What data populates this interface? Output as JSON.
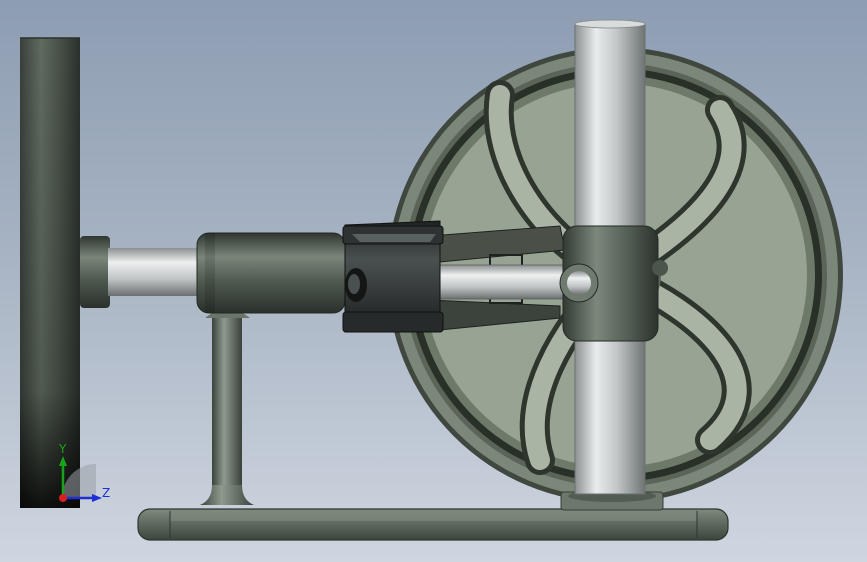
{
  "viewport": {
    "background_top": "#8d9db2",
    "background_bottom": "#cfd6e0"
  },
  "model": {
    "body_color": "#5e6a5e",
    "shaft_color": "#c9cfcf",
    "wheel_color": "#6b7768",
    "piston_color": "#2b2e2e"
  },
  "triad": {
    "y_label": "Y",
    "z_label": "Z",
    "y_color": "#1aa31a",
    "z_color": "#1f2fd6",
    "x_color": "#d62020"
  }
}
